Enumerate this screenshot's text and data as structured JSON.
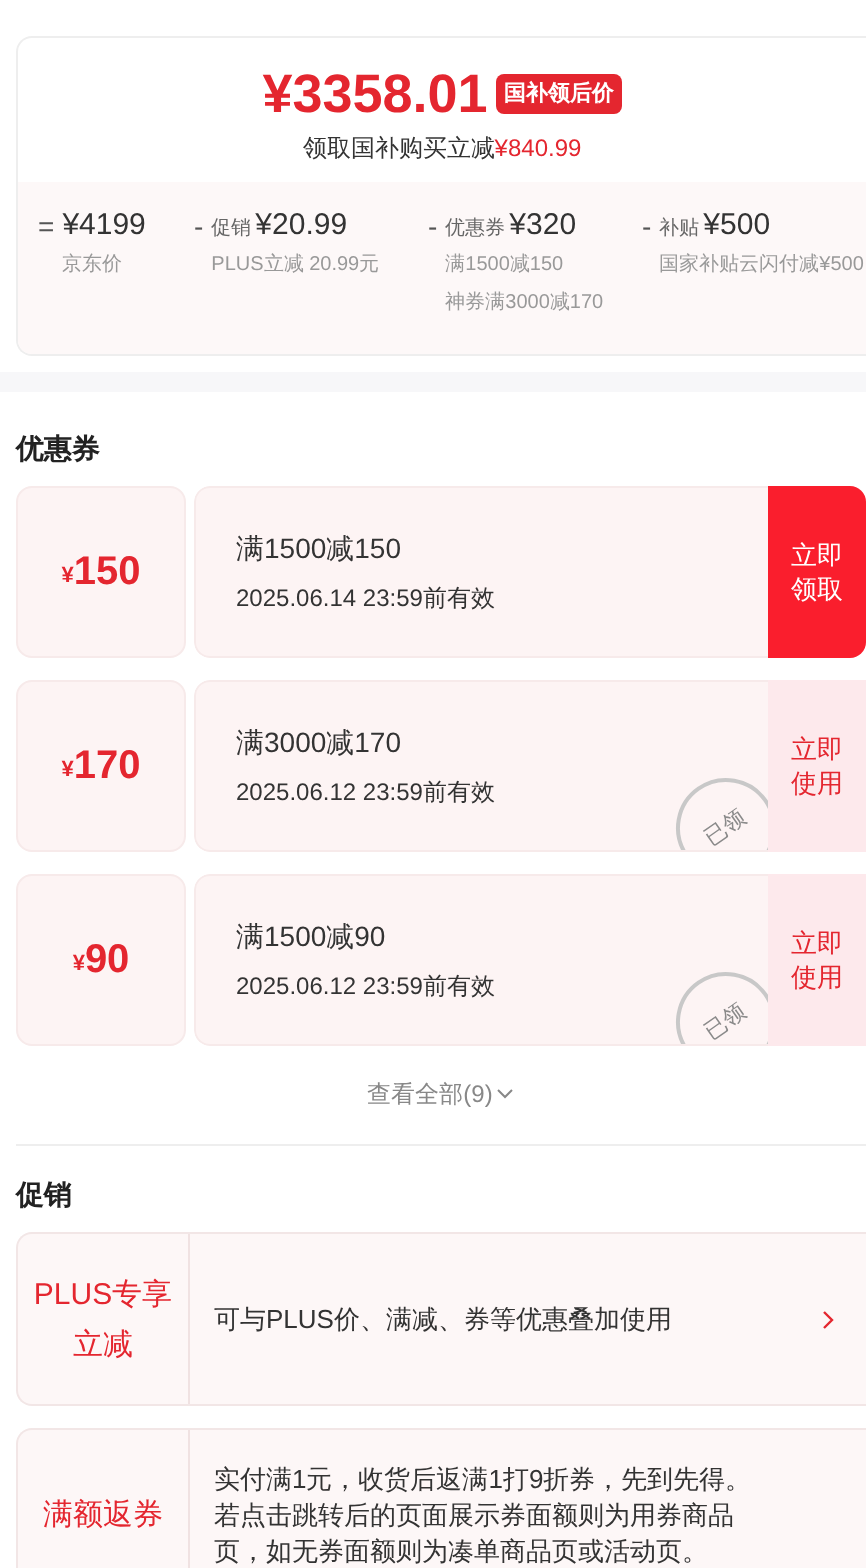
{
  "price_card": {
    "price": "¥3358.01",
    "price_tag": "国补领后价",
    "saving_label": "领取国补购买立减",
    "saving_amount": "¥840.99",
    "breakdown": [
      {
        "operator": "=",
        "amount": "¥4199",
        "notes": [
          "京东价"
        ]
      },
      {
        "operator": "-",
        "label": "促销",
        "amount": "¥20.99",
        "notes": [
          "PLUS立减 20.99元"
        ]
      },
      {
        "operator": "-",
        "label": "优惠券",
        "amount": "¥320",
        "notes": [
          "满1500减150",
          "神券满3000减170"
        ]
      },
      {
        "operator": "-",
        "label": "补贴",
        "amount": "¥500",
        "notes": [
          "国家补贴云闪付减¥500"
        ]
      }
    ]
  },
  "coupons": {
    "title": "优惠券",
    "items": [
      {
        "currency": "¥",
        "amount": "150",
        "condition": "满1500减150",
        "validity": "2025.06.14 23:59前有效",
        "claimed": false,
        "action": "立即领取"
      },
      {
        "currency": "¥",
        "amount": "170",
        "condition": "满3000减170",
        "validity": "2025.06.12 23:59前有效",
        "claimed": true,
        "stamp": "已领",
        "action": "立即使用"
      },
      {
        "currency": "¥",
        "amount": "90",
        "condition": "满1500减90",
        "validity": "2025.06.12 23:59前有效",
        "claimed": true,
        "stamp": "已领",
        "action": "立即使用"
      }
    ],
    "view_all": "查看全部(9)"
  },
  "promotions": {
    "title": "促销",
    "items": [
      {
        "tag": "PLUS专享立减",
        "description": "可与PLUS价、满减、券等优惠叠加使用",
        "has_arrow": true
      },
      {
        "tag": "满额返券",
        "description": "实付满1元，收货后返满1打9折券，先到先得。若点击跳转后的页面展示券面额则为用券商品页，如无券面额则为凑单商品页或活动页。",
        "has_arrow": false
      }
    ]
  }
}
